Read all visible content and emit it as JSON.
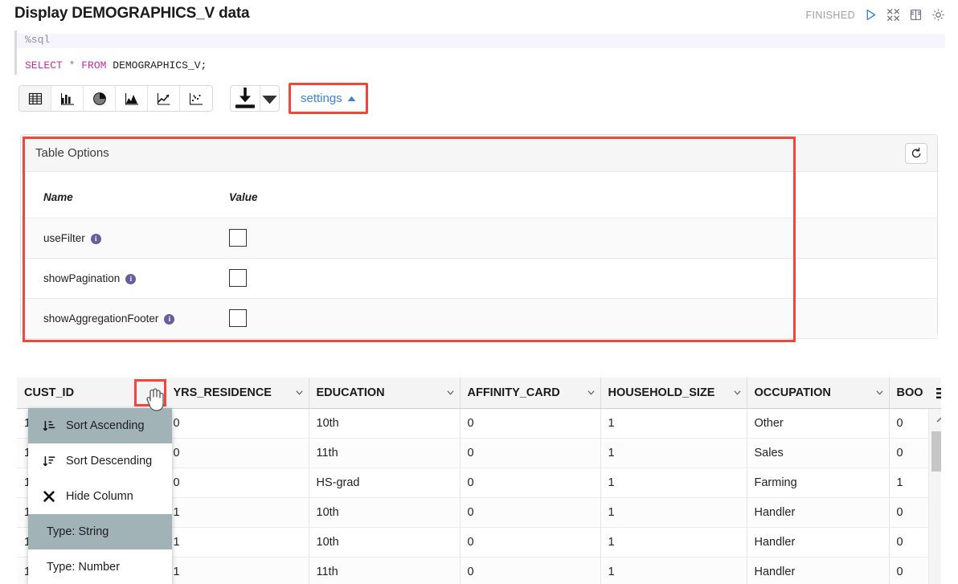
{
  "paragraph": {
    "title": "Display DEMOGRAPHICS_V data",
    "status": "FINISHED",
    "header_icons": [
      "run-icon",
      "collapse-icon",
      "book-icon",
      "gear-icon"
    ]
  },
  "editor": {
    "interpreter": "%sql",
    "sql": {
      "keyword1": "SELECT",
      "star": "*",
      "keyword2": "FROM",
      "table": "DEMOGRAPHICS_V;"
    }
  },
  "toolbar": {
    "viz_buttons": [
      {
        "name": "table-chart-button",
        "icon": "table-icon",
        "active": true
      },
      {
        "name": "bar-chart-button",
        "icon": "bar-chart-icon",
        "active": false
      },
      {
        "name": "pie-chart-button",
        "icon": "pie-chart-icon",
        "active": false
      },
      {
        "name": "area-chart-button",
        "icon": "area-chart-icon",
        "active": false
      },
      {
        "name": "line-chart-button",
        "icon": "line-chart-icon",
        "active": false
      },
      {
        "name": "scatter-chart-button",
        "icon": "scatter-chart-icon",
        "active": false
      }
    ],
    "download_icon": "download-icon",
    "download_caret_icon": "caret-down-icon",
    "settings_label": "settings",
    "settings_caret_icon": "caret-up-icon"
  },
  "settings_panel": {
    "title": "Table Options",
    "reset_icon": "reset-icon",
    "columns": {
      "name": "Name",
      "value": "Value"
    },
    "rows": [
      {
        "name": "useFilter",
        "info_icon": "info-icon",
        "value_checked": false
      },
      {
        "name": "showPagination",
        "info_icon": "info-icon",
        "value_checked": false
      },
      {
        "name": "showAggregationFooter",
        "info_icon": "info-icon",
        "value_checked": false
      }
    ]
  },
  "grid": {
    "columns": [
      {
        "label": "CUST_ID",
        "caret": "chevron-down-icon"
      },
      {
        "label": "YRS_RESIDENCE",
        "caret": "chevron-down-icon"
      },
      {
        "label": "EDUCATION",
        "caret": "chevron-down-icon"
      },
      {
        "label": "AFFINITY_CARD",
        "caret": "chevron-down-icon"
      },
      {
        "label": "HOUSEHOLD_SIZE",
        "caret": "chevron-down-icon"
      },
      {
        "label": "OCCUPATION",
        "caret": "chevron-down-icon"
      },
      {
        "label": "BOO",
        "caret": ""
      }
    ],
    "menu_icon": "hamburger-menu-icon",
    "scroll_up_icon": "chevron-up-icon",
    "rows": [
      [
        "1",
        "0",
        "10th",
        "0",
        "1",
        "Other",
        "0"
      ],
      [
        "1",
        "0",
        "11th",
        "0",
        "1",
        "Sales",
        "0"
      ],
      [
        "1",
        "0",
        "HS-grad",
        "0",
        "1",
        "Farming",
        "1"
      ],
      [
        "1",
        "1",
        "10th",
        "0",
        "1",
        "Handler",
        "0"
      ],
      [
        "1",
        "1",
        "10th",
        "0",
        "1",
        "Handler",
        "0"
      ],
      [
        "1",
        "1",
        "11th",
        "0",
        "1",
        "Handler",
        "0"
      ]
    ]
  },
  "context_menu": {
    "items": [
      {
        "label": "Sort Ascending",
        "icon": "sort-ascending-icon",
        "selected": true
      },
      {
        "label": "Sort Descending",
        "icon": "sort-descending-icon",
        "selected": false
      },
      {
        "label": "Hide Column",
        "icon": "close-x-icon",
        "selected": false
      },
      {
        "label": "Type: String",
        "icon": "",
        "selected": true
      },
      {
        "label": "Type: Number",
        "icon": "",
        "selected": false
      }
    ]
  },
  "colors": {
    "highlight_red": "#f4453c",
    "link_blue": "#3a84d8",
    "sql_keyword": "#c22fa0",
    "menu_selected": "#a2b3b8",
    "info_purple": "#6a5d9e"
  }
}
